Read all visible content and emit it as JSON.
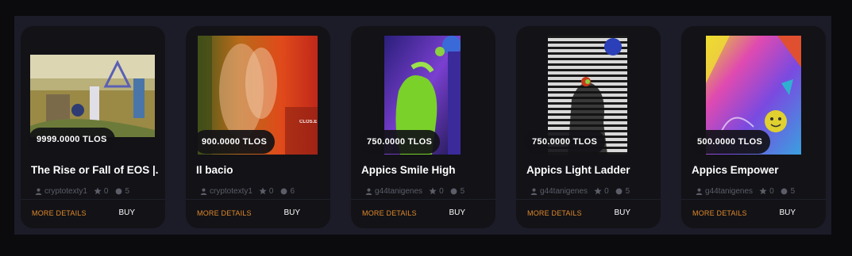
{
  "cards": [
    {
      "price": "9999.0000 TLOS",
      "title": "The Rise or Fall of EOS |...",
      "creator": "cryptotexty1",
      "likes": "0",
      "count": "5",
      "more_label": "MORE DETAILS",
      "buy_label": "BUY"
    },
    {
      "price": "900.0000 TLOS",
      "title": "Il bacio",
      "creator": "cryptotexty1",
      "likes": "0",
      "count": "6",
      "more_label": "MORE DETAILS",
      "buy_label": "BUY",
      "image_caption": "CLOS.E"
    },
    {
      "price": "750.0000 TLOS",
      "title": "Appics Smile High",
      "creator": "g44tanigenes",
      "likes": "0",
      "count": "5",
      "more_label": "MORE DETAILS",
      "buy_label": "BUY"
    },
    {
      "price": "750.0000 TLOS",
      "title": "Appics Light Ladder",
      "creator": "g44tanigenes",
      "likes": "0",
      "count": "5",
      "more_label": "MORE DETAILS",
      "buy_label": "BUY"
    },
    {
      "price": "500.0000 TLOS",
      "title": "Appics Empower",
      "creator": "g44tanigenes",
      "likes": "0",
      "count": "5",
      "more_label": "MORE DETAILS",
      "buy_label": "BUY"
    }
  ],
  "icons": {
    "creator": "user-icon",
    "likes": "star-icon",
    "count": "circle-icon"
  },
  "colors": {
    "accent": "#e0892a",
    "card_bg": "#121217",
    "panel_bg": "#1b1c27",
    "muted_text": "#5c5d68"
  }
}
